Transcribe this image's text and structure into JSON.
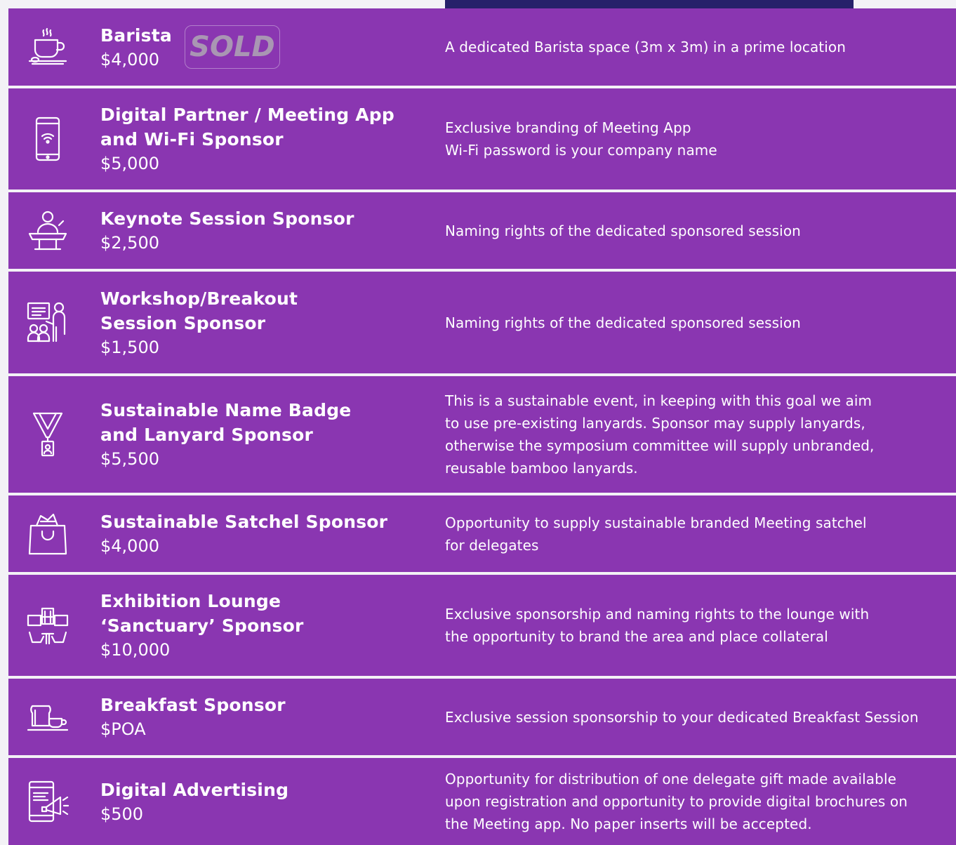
{
  "colors": {
    "row_background": "#8a36b1",
    "page_background": "#f3f2f6",
    "top_bar": "#26216a",
    "text": "#ffffff"
  },
  "sponsorships": [
    {
      "icon": "coffee-cup-icon",
      "title": "Barista",
      "price": "$4,000",
      "badge": "SOLD",
      "description": "A dedicated Barista space (3m x 3m) in a prime location"
    },
    {
      "icon": "smartphone-wifi-icon",
      "title": "Digital Partner / Meeting App\nand Wi-Fi Sponsor",
      "price": "$5,000",
      "description": "Exclusive branding of Meeting App\nWi-Fi password is your company name"
    },
    {
      "icon": "keynote-speaker-icon",
      "title": "Keynote Session Sponsor",
      "price": "$2,500",
      "description": "Naming rights of the dedicated sponsored session"
    },
    {
      "icon": "workshop-presentation-icon",
      "title": "Workshop/Breakout\nSession Sponsor",
      "price": "$1,500",
      "description": "Naming rights of the dedicated sponsored session"
    },
    {
      "icon": "lanyard-badge-icon",
      "title": "Sustainable Name Badge\nand Lanyard Sponsor",
      "price": "$5,500",
      "description": "This is a sustainable event, in keeping with this goal we aim\nto use pre-existing lanyards. Sponsor may supply lanyards,\notherwise the symposium committee will supply unbranded,\nreusable bamboo lanyards."
    },
    {
      "icon": "satchel-bag-icon",
      "title": "Sustainable Satchel Sponsor",
      "price": "$4,000",
      "description": "Opportunity to supply sustainable branded Meeting satchel\nfor delegates"
    },
    {
      "icon": "lounge-icon",
      "title": "Exhibition Lounge\n‘Sanctuary’ Sponsor",
      "price": "$10,000",
      "description": "Exclusive sponsorship and naming rights to the lounge with\nthe opportunity to brand the area and place collateral"
    },
    {
      "icon": "breakfast-toast-coffee-icon",
      "title": "Breakfast Sponsor",
      "price": "$POA",
      "description": "Exclusive session sponsorship to your dedicated Breakfast Session"
    },
    {
      "icon": "digital-advertising-megaphone-icon",
      "title": "Digital Advertising",
      "price": "$500",
      "description": "Opportunity for distribution of one delegate gift made available\nupon registration and opportunity to provide digital brochures on\nthe Meeting app. No paper inserts will be accepted."
    }
  ]
}
